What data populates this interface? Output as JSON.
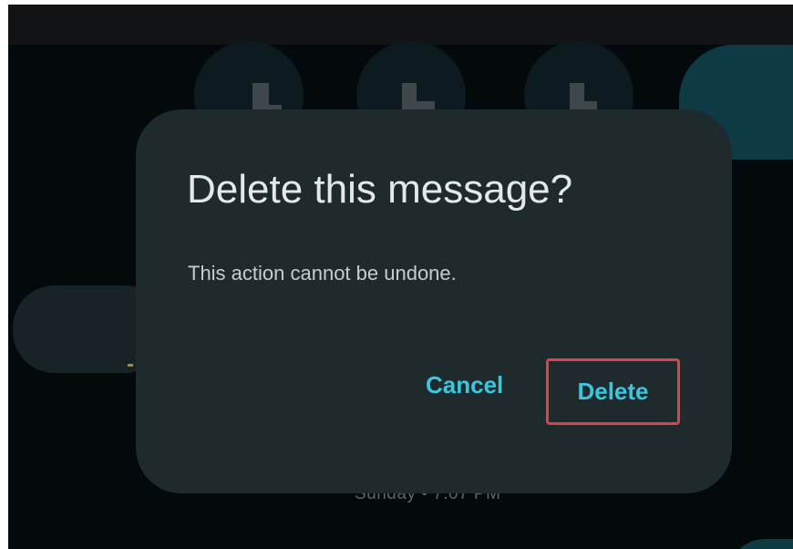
{
  "dialog": {
    "title": "Delete this message?",
    "body": "This action cannot be undone.",
    "cancel_label": "Cancel",
    "delete_label": "Delete"
  },
  "background": {
    "timestamp": "Sunday • 7:07 PM"
  },
  "colors": {
    "dialog_surface": "#1f2a2d",
    "accent": "#39c6de",
    "highlight_border": "#d6454f",
    "screen_background": "#04090c"
  }
}
